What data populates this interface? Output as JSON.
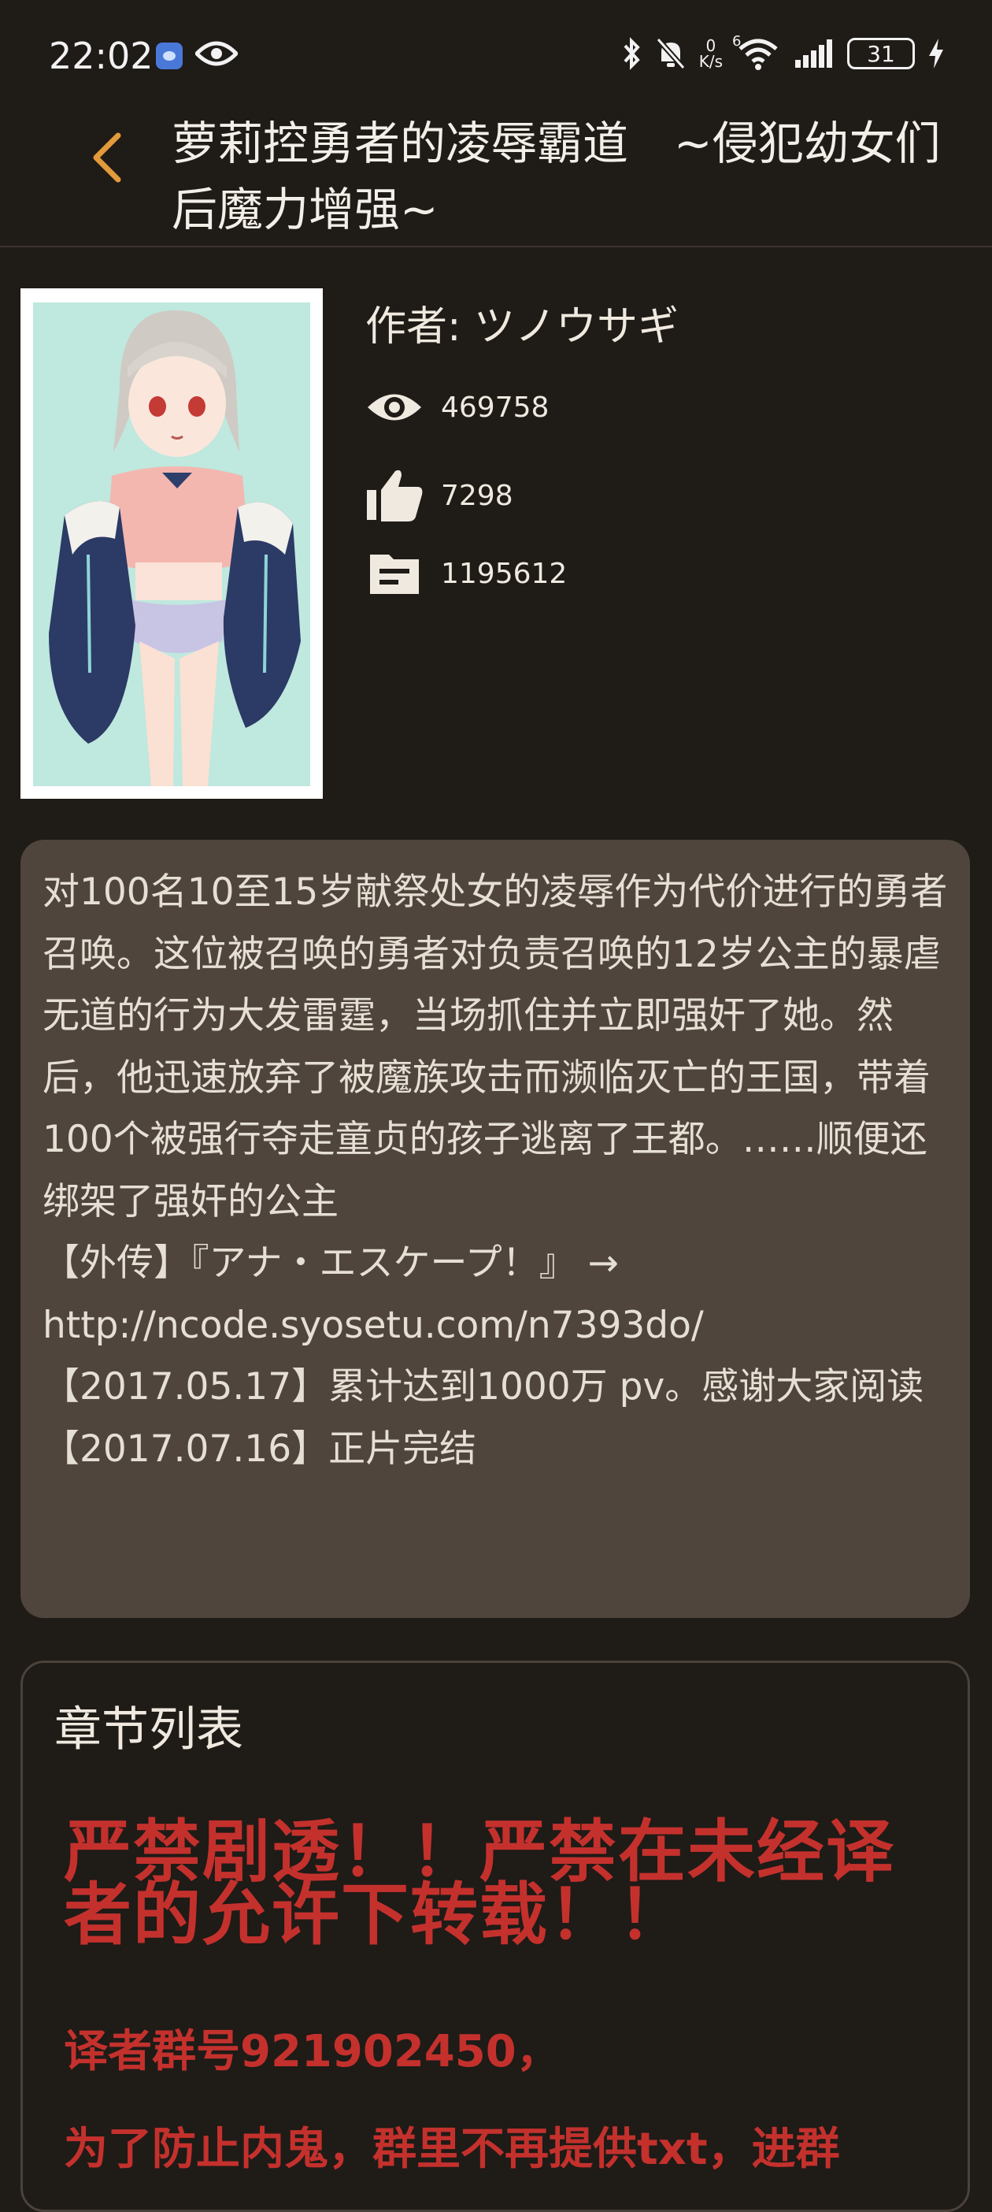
{
  "status_bar": {
    "time": "22:02",
    "network_speed_value": "0",
    "network_speed_unit": "K/s",
    "wifi_label": "6",
    "battery": "31",
    "icons": [
      "app-badge-icon",
      "eye-icon",
      "bluetooth-icon",
      "mute-icon",
      "wifi-icon",
      "signal-icon",
      "charging-icon"
    ]
  },
  "header": {
    "back_icon": "chevron-left-icon",
    "title": "萝莉控勇者的凌辱霸道　~侵犯幼女们后魔力增强~"
  },
  "book": {
    "author": "作者: ツノウサギ",
    "stats": {
      "views": "469758",
      "likes": "7298",
      "words": "1195612"
    },
    "description": "对100名10至15岁献祭处女的凌辱作为代价进行的勇者召唤。这位被召唤的勇者对负责召唤的12岁公主的暴虐无道的行为大发雷霆，当场抓住并立即强奸了她。然后，他迅速放弃了被魔族攻击而濒临灭亡的王国，带着100个被强行夺走童贞的孩子逃离了王都。……顺便还绑架了强奸的公主\n【外传】『アナ・エスケープ！』 →\nhttp://ncode.syosetu.com/n7393do/\n【2017.05.17】累计达到1000万 pv。感谢大家阅读\n【2017.07.16】正片完结"
  },
  "chapters": {
    "title": "章节列表",
    "warning": "严禁剧透！！严禁在未经译者的允许下转载！！",
    "group_number": "译者群号921902450，",
    "next_line": "为了防止内鬼，群里不再提供txt，进群"
  },
  "colors": {
    "background": "#1f1b17",
    "accent_back": "#e39a3b",
    "card": "#4f453c",
    "warning_red": "#c4312d"
  }
}
